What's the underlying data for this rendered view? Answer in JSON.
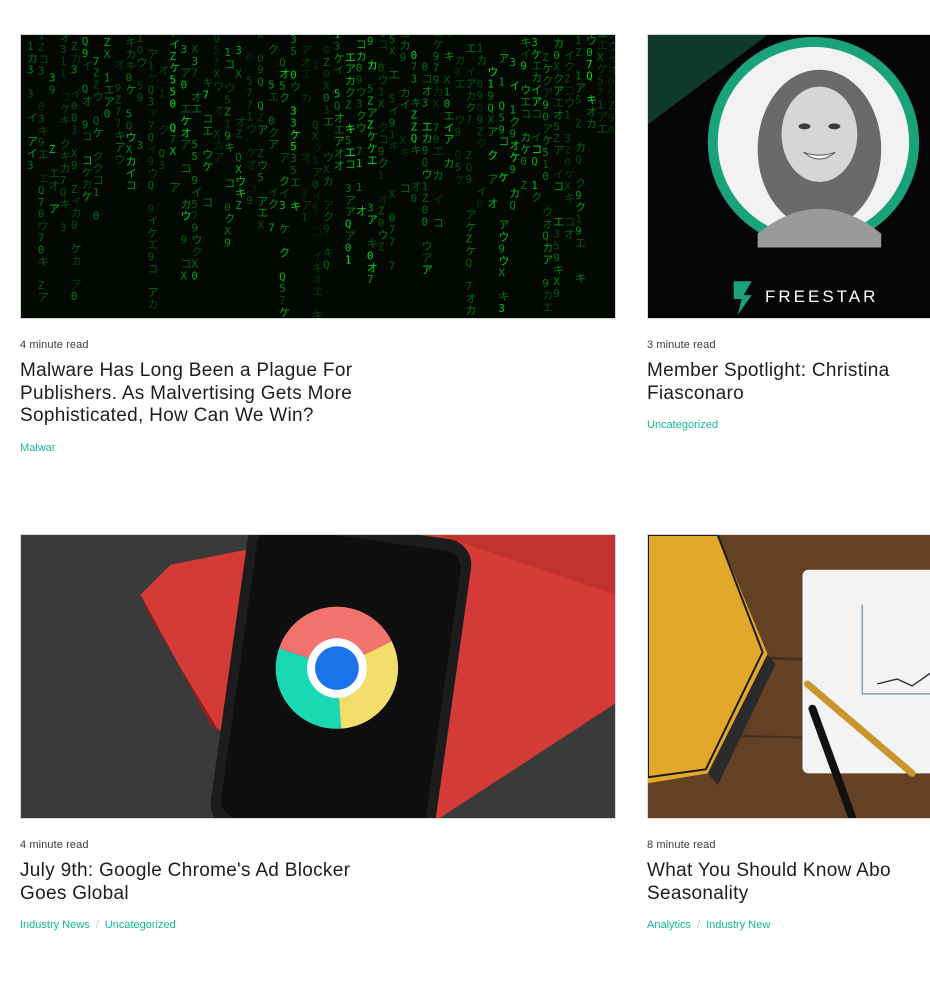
{
  "posts": [
    {
      "read_time": "4 minute read",
      "title": "Malware Has Long Been a Plague For Publishers. As Malvertising Gets More Sophisticated, How Can We Win?",
      "tags": [
        "Malwar"
      ],
      "image": "matrix-code-image"
    },
    {
      "read_time": "3 minute read",
      "title_line1": "Member Spotlight: Christina",
      "title_line2": "Fiasconaro",
      "tags": [
        "Uncategorized"
      ],
      "image": "freestar-portrait-image",
      "logo_text": "FREESTAR"
    },
    {
      "read_time": "4 minute read",
      "title": "July 9th: Google Chrome's Ad Blocker Goes Global",
      "tags": [
        "Industry News",
        "Uncategorized"
      ],
      "image": "phone-chrome-logo-image"
    },
    {
      "read_time": "8 minute read",
      "title_line1": "What You Should Know Abo",
      "title_line2": "Seasonality",
      "tags": [
        "Analytics",
        "Industry New"
      ],
      "image": "notebook-pen-desk-image"
    }
  ],
  "tag_separator": "/",
  "colors": {
    "accent": "#13b897",
    "title": "#1d1d1d",
    "brand_green": "#1aa37a"
  }
}
